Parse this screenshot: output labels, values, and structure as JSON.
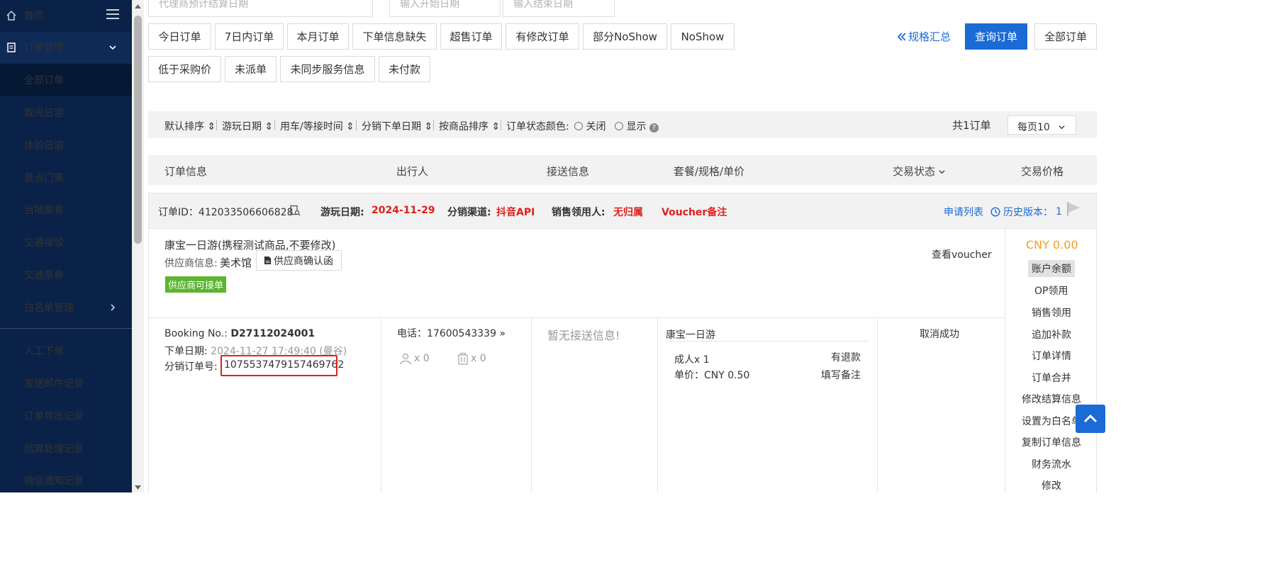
{
  "sidebar": {
    "items": [
      {
        "label": "首页"
      },
      {
        "label": "订单管理"
      },
      {
        "label": "全部订单"
      },
      {
        "label": "观光日游"
      },
      {
        "label": "体验日游"
      },
      {
        "label": "景点门票"
      },
      {
        "label": "当地美食"
      },
      {
        "label": "交通接驳"
      },
      {
        "label": "交通票券"
      },
      {
        "label": "白名单管理"
      },
      {
        "label": "人工下单"
      },
      {
        "label": "发送邮件记录"
      },
      {
        "label": "订单导出记录"
      },
      {
        "label": "结算处理记录"
      },
      {
        "label": "微信通知记录"
      }
    ]
  },
  "search": {
    "settle_date_placeholder": "代理商预计结算日期",
    "start_date_placeholder": "输入开始日期",
    "end_date_placeholder": "输入结束日期"
  },
  "filters": {
    "row1": [
      "今日订单",
      "7日内订单",
      "本月订单",
      "下单信息缺失",
      "超售订单",
      "有修改订单",
      "部分NoShow",
      "NoShow"
    ],
    "row2": [
      "低于采购价",
      "未派单",
      "未同步服务信息",
      "未付款"
    ]
  },
  "toolbar": {
    "spec_summary": "规格汇总",
    "query": "查询订单",
    "all": "全部订单"
  },
  "sortbar": {
    "items": [
      "默认排序",
      "游玩日期",
      "用车/等接时间",
      "分销下单日期",
      "按商品排序"
    ],
    "color_label": "订单状态颜色:",
    "close": "关闭",
    "show": "显示",
    "total": "共1订单",
    "page_size": "每页10"
  },
  "table_headers": [
    "订单信息",
    "出行人",
    "接送信息",
    "套餐/规格/单价",
    "交易状态",
    "交易价格"
  ],
  "order": {
    "id_label": "订单ID：",
    "id": "412033506606828",
    "play_date_label": "游玩日期:",
    "play_date": "2024-11-29",
    "channel_label": "分销渠道:",
    "channel": "抖音API",
    "sales_label": "销售领用人:",
    "sales": "无归属",
    "voucher_note": "Voucher备注",
    "apply_list": "申请列表",
    "history_label": "历史版本：",
    "history_count": "1",
    "product_name": "康宝一日游(携程测试商品,不要修改)",
    "supplier_label": "供应商信息:",
    "supplier": "美术馆",
    "supplier_confirm": "供应商确认函",
    "supplier_badge": "供应商可接单",
    "view_voucher": "查看voucher",
    "booking_label": "Booking No.:",
    "booking_no": "D27112024001",
    "order_date_label": "下单日期:",
    "order_date": "2024-11-27 17:49:40 (曼谷)",
    "dist_order_label": "分销订单号:",
    "dist_order_no": "1075537479157469762",
    "phone_label": "电话：",
    "phone": "17600543339",
    "adult_count": "x 0",
    "luggage_count": "x 0",
    "no_transfer": "暂无接送信息!",
    "package_name": "康宝一日游",
    "spec": "成人x 1",
    "refund": "有退款",
    "unit_price": "单价：CNY 0.50",
    "fill_note": "填写备注",
    "status": "取消成功",
    "price": "CNY 0.00",
    "balance": "账户余额",
    "actions": [
      "OP领用",
      "销售领用",
      "追加补款",
      "订单详情",
      "订单合并",
      "修改结算信息",
      "设置为白名单",
      "复制订单信息",
      "财务流水",
      "修改"
    ]
  }
}
